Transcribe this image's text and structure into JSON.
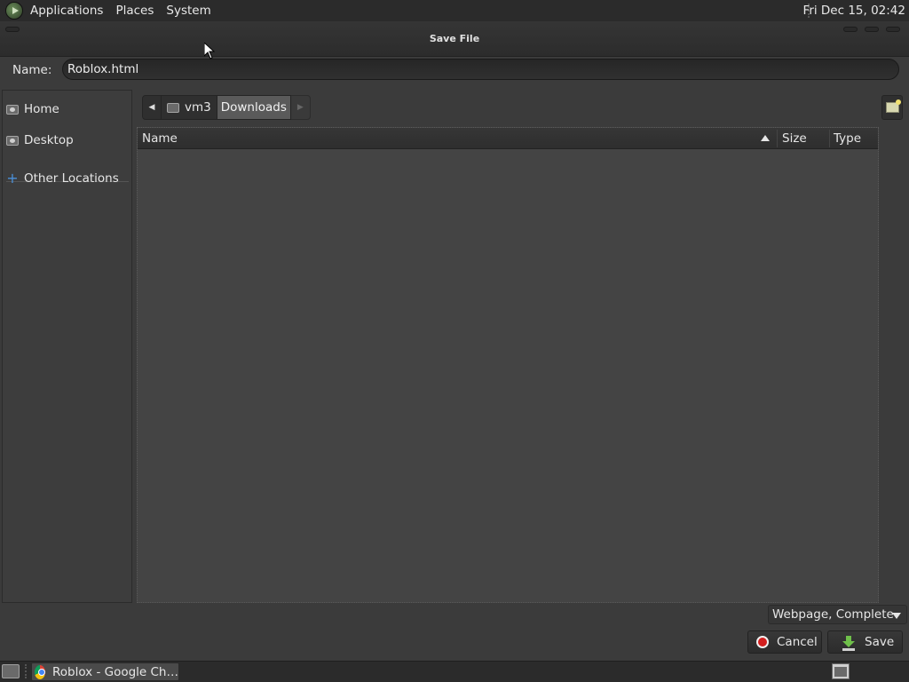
{
  "top_panel": {
    "menus": [
      "Applications",
      "Places",
      "System"
    ],
    "clock": "Fri Dec 15, 02:42"
  },
  "dialog": {
    "title": "Save File",
    "name_label": "Name:",
    "name_value": "Roblox.html",
    "sidebar": {
      "items": [
        {
          "label": "Home",
          "icon": "home-folder-icon"
        },
        {
          "label": "Desktop",
          "icon": "desktop-folder-icon"
        },
        {
          "label": "Other Locations",
          "icon": "plus-icon"
        }
      ]
    },
    "path": {
      "segments": [
        "vm3",
        "Downloads"
      ],
      "current": "Downloads"
    },
    "columns": [
      "Name",
      "Size",
      "Type"
    ],
    "sort": {
      "column": "Name",
      "direction": "ascending"
    },
    "files": [],
    "filter": "Webpage, Complete",
    "buttons": {
      "cancel": "Cancel",
      "save": "Save"
    }
  },
  "taskbar": {
    "tasks": [
      {
        "label": "Roblox - Google Ch…",
        "icon": "chrome-icon"
      }
    ]
  },
  "colors": {
    "panel_bg": "#2b2b2b",
    "window_bg": "#3b3b3b",
    "list_bg": "#444444",
    "cancel_icon": "#d21e1e",
    "save_icon": "#6fc04a",
    "other_locations_icon": "#4a90d9"
  }
}
